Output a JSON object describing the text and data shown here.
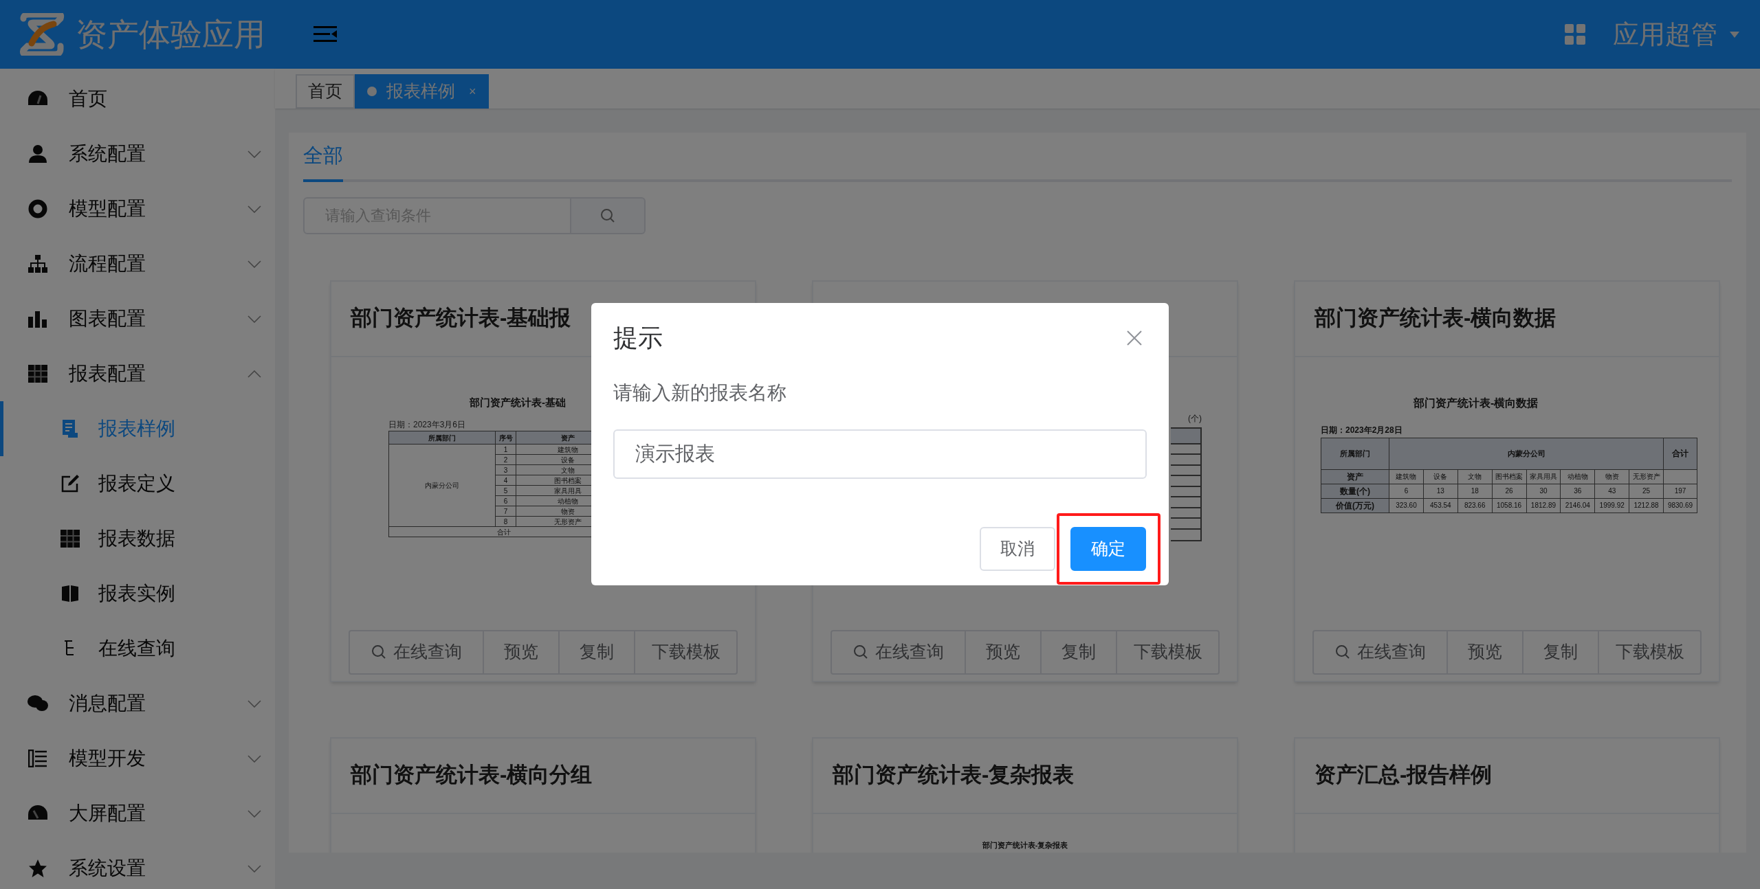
{
  "header": {
    "app_title": "资产体验应用",
    "user_name": "应用超管"
  },
  "sidebar": {
    "items": [
      {
        "label": "首页",
        "kind": "link",
        "selected": false
      },
      {
        "label": "系统配置",
        "kind": "group",
        "expanded": false,
        "selected": false
      },
      {
        "label": "模型配置",
        "kind": "group",
        "expanded": false,
        "selected": false
      },
      {
        "label": "流程配置",
        "kind": "group",
        "expanded": false,
        "selected": false
      },
      {
        "label": "图表配置",
        "kind": "group",
        "expanded": false,
        "selected": false
      },
      {
        "label": "报表配置",
        "kind": "group",
        "expanded": true,
        "selected": false,
        "children": [
          {
            "label": "报表样例",
            "selected": true
          },
          {
            "label": "报表定义",
            "selected": false
          },
          {
            "label": "报表数据",
            "selected": false
          },
          {
            "label": "报表实例",
            "selected": false
          },
          {
            "label": "在线查询",
            "selected": false
          }
        ]
      },
      {
        "label": "消息配置",
        "kind": "group",
        "expanded": false,
        "selected": false
      },
      {
        "label": "模型开发",
        "kind": "group",
        "expanded": false,
        "selected": false
      },
      {
        "label": "大屏配置",
        "kind": "group",
        "expanded": false,
        "selected": false
      },
      {
        "label": "系统设置",
        "kind": "group",
        "expanded": false,
        "selected": false
      }
    ]
  },
  "tabs": [
    {
      "label": "首页",
      "selected": false
    },
    {
      "label": "报表样例",
      "selected": true,
      "close": "×"
    }
  ],
  "filter_tabs": [
    {
      "label": "全部",
      "selected": true
    }
  ],
  "search": {
    "placeholder": "请输入查询条件"
  },
  "cards": [
    {
      "title": "部门资产统计表-基础报",
      "preview": {
        "kind": "vertical",
        "title": "部门资产统计表-基础",
        "date": "日期：2023年3月6日",
        "headers": [
          "所属部门",
          "序号",
          "资产"
        ],
        "department": "内蒙分公司",
        "rows": [
          [
            "1",
            "建筑物"
          ],
          [
            "2",
            "设备"
          ],
          [
            "3",
            "文物"
          ],
          [
            "4",
            "图书档案"
          ],
          [
            "5",
            "家具用具"
          ],
          [
            "6",
            "动植物"
          ],
          [
            "7",
            "物资"
          ],
          [
            "8",
            "无形资产"
          ]
        ],
        "total": "合计"
      },
      "actions": [
        "在线查询",
        "预览",
        "复制",
        "下载模板"
      ]
    },
    {
      "preview": {
        "kind": "partial",
        "caption": "(个)"
      },
      "actions": [
        "在线查询",
        "预览",
        "复制",
        "下载模板"
      ]
    },
    {
      "title": "部门资产统计表-横向数据",
      "preview": {
        "kind": "horizontal",
        "title": "部门资产统计表-横向数据",
        "date": "日期：2023年2月28日",
        "corner": "所属部门",
        "department": "内蒙分公司",
        "total": "合计",
        "asset_label": "资产",
        "assets": [
          "建筑物",
          "设备",
          "文物",
          "图书档案",
          "家具用具",
          "动植物",
          "物资",
          "无形资产"
        ],
        "rows": [
          {
            "label": "数量(个)",
            "cells": [
              "6",
              "13",
              "18",
              "26",
              "30",
              "36",
              "43",
              "25",
              "197"
            ]
          },
          {
            "label": "价值(万元)",
            "cells": [
              "323.60",
              "453.54",
              "823.66",
              "1058.16",
              "1812.89",
              "2146.04",
              "1999.92",
              "1212.88",
              "9830.69"
            ]
          }
        ]
      },
      "actions": [
        "在线查询",
        "预览",
        "复制",
        "下载模板"
      ]
    },
    {
      "title": "部门资产统计表-横向分组"
    },
    {
      "title": "部门资产统计表-复杂报表",
      "preview": {
        "kind": "title_only",
        "title": "部门资产统计表-复杂报表"
      }
    },
    {
      "title": "资产汇总-报告样例"
    }
  ],
  "dialog": {
    "title": "提示",
    "message": "请输入新的报表名称",
    "input_value": "演示报表",
    "buttons": [
      {
        "label": "取消",
        "kind": "default",
        "highlighted": false
      },
      {
        "label": "确定",
        "kind": "primary",
        "highlighted": true
      }
    ]
  }
}
